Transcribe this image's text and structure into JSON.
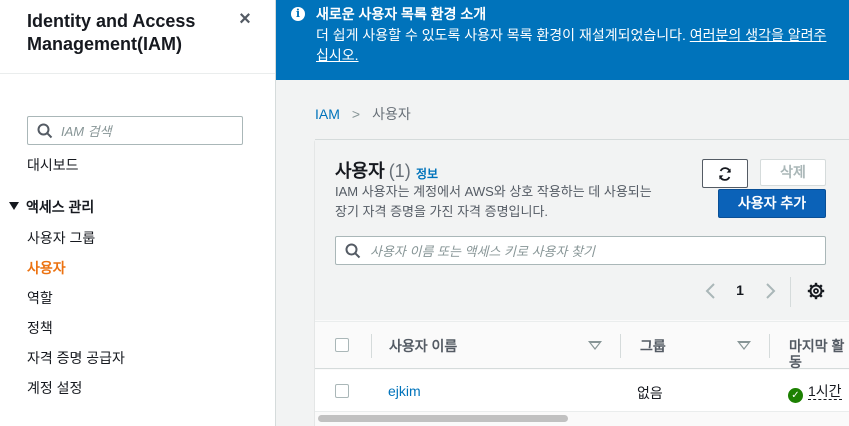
{
  "sidebar": {
    "title": "Identity and Access Management(IAM)",
    "search_placeholder": "IAM 검색",
    "dashboard": "대시보드",
    "section": "액세스 관리",
    "items": [
      {
        "label": "사용자 그룹"
      },
      {
        "label": "사용자",
        "active": true
      },
      {
        "label": "역할"
      },
      {
        "label": "정책"
      },
      {
        "label": "자격 증명 공급자"
      },
      {
        "label": "계정 설정"
      }
    ]
  },
  "banner": {
    "title": "새로운 사용자 목록 환경 소개",
    "text": "더 쉽게 사용할 수 있도록 사용자 목록 환경이 재설계되었습니다. ",
    "link": "여러분의 생각을 알려주십시오.",
    "trail": "."
  },
  "breadcrumb": {
    "root": "IAM",
    "current": "사용자"
  },
  "users_panel": {
    "title": "사용자",
    "count": "(1)",
    "info": "정보",
    "description": "IAM 사용자는 계정에서 AWS와 상호 작용하는 데 사용되는 장기 자격 증명을 가진 자격 증명입니다.",
    "delete_label": "삭제",
    "add_label": "사용자 추가",
    "search_placeholder": "사용자 이름 또는 액세스 키로 사용자 찾기",
    "page": "1"
  },
  "table": {
    "columns": [
      "사용자 이름",
      "그룹",
      "마지막 활동"
    ],
    "rows": [
      {
        "user": "ejkim",
        "group": "없음",
        "last_activity": "1시간"
      }
    ]
  },
  "colors": {
    "banner": "#0073bb",
    "active_nav": "#ec7211",
    "link": "#0073bb",
    "primary_button": "#0b62b8",
    "success": "#1d8102"
  }
}
